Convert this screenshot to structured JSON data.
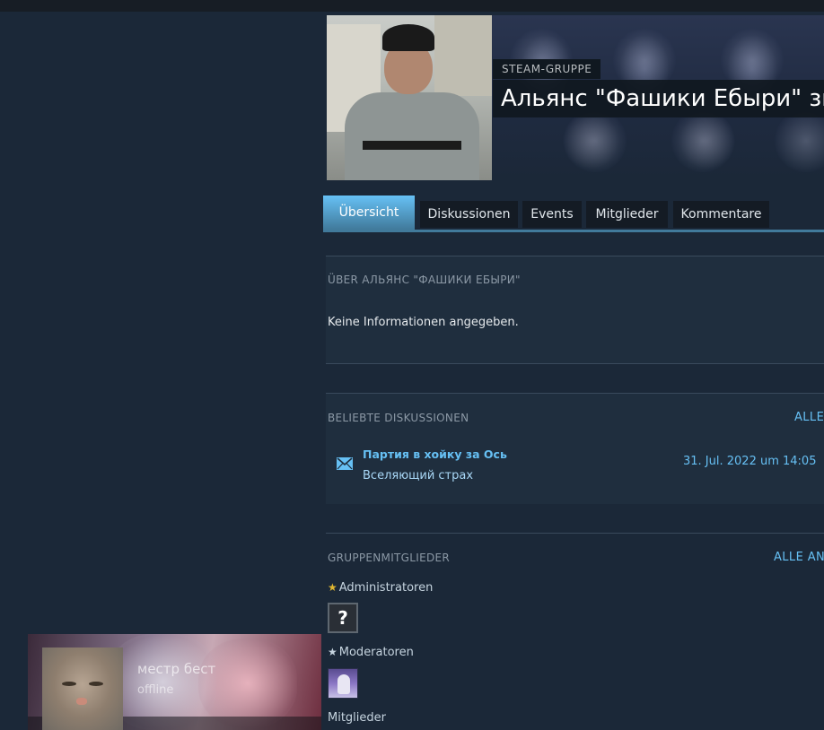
{
  "header": {
    "group_label": "STEAM-GRUPPE",
    "group_title": "Альянс \"Фашики Ебыри\" зн"
  },
  "tabs": [
    {
      "label": "Übersicht",
      "active": true
    },
    {
      "label": "Diskussionen",
      "active": false
    },
    {
      "label": "Events",
      "active": false
    },
    {
      "label": "Mitglieder",
      "active": false
    },
    {
      "label": "Kommentare",
      "active": false
    }
  ],
  "about": {
    "title": "ÜBER АЛЬЯНС \"ФАШИКИ ЕБЫРИ\"",
    "text": "Keine Informationen angegeben."
  },
  "discussions": {
    "title": "BELIEBTE DISKUSSIONEN",
    "view_all": "ALLE",
    "items": [
      {
        "title": "Партия в хойку за Ось",
        "author": "Вселяющий страх",
        "date": "31. Jul. 2022 um 14:05"
      }
    ]
  },
  "members": {
    "title": "GRUPPENMITGLIEDER",
    "view_all": "ALLE AN",
    "admins_label": "Administratoren",
    "admin_avatar_text": "?",
    "mods_label": "Moderatoren",
    "members_label": "Mitglieder"
  },
  "friend": {
    "name": "местр бест",
    "status": "offline"
  },
  "colors": {
    "background": "#1b2838",
    "link": "#66c0f4",
    "tab_active": "#67c1f5",
    "admin_star": "#e1b731"
  },
  "icons": {
    "discussion": "envelope-icon",
    "admin": "gold-star-icon",
    "moderator": "silver-star-icon"
  }
}
